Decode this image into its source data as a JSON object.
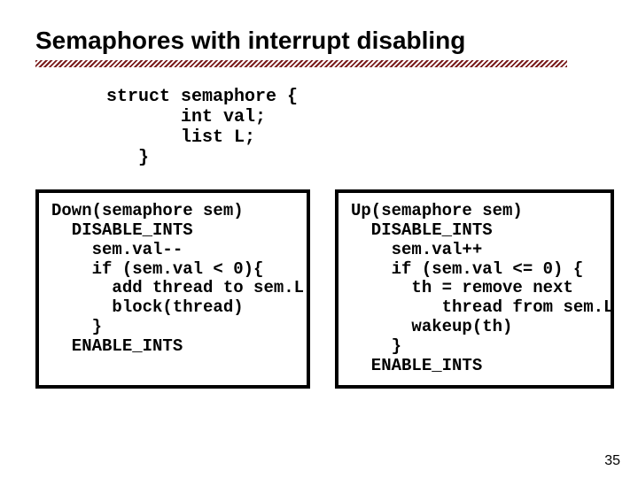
{
  "title": "Semaphores with interrupt disabling",
  "struct_code": "struct semaphore {\n       int val;\n       list L;\n   }",
  "down_code": "Down(semaphore sem)\n  DISABLE_INTS\n    sem.val--\n    if (sem.val < 0){\n      add thread to sem.L\n      block(thread)\n    }\n  ENABLE_INTS",
  "up_code": "Up(semaphore sem)\n  DISABLE_INTS\n    sem.val++\n    if (sem.val <= 0) {\n      th = remove next\n         thread from sem.L\n      wakeup(th)\n    }\n  ENABLE_INTS",
  "page_number": "35"
}
